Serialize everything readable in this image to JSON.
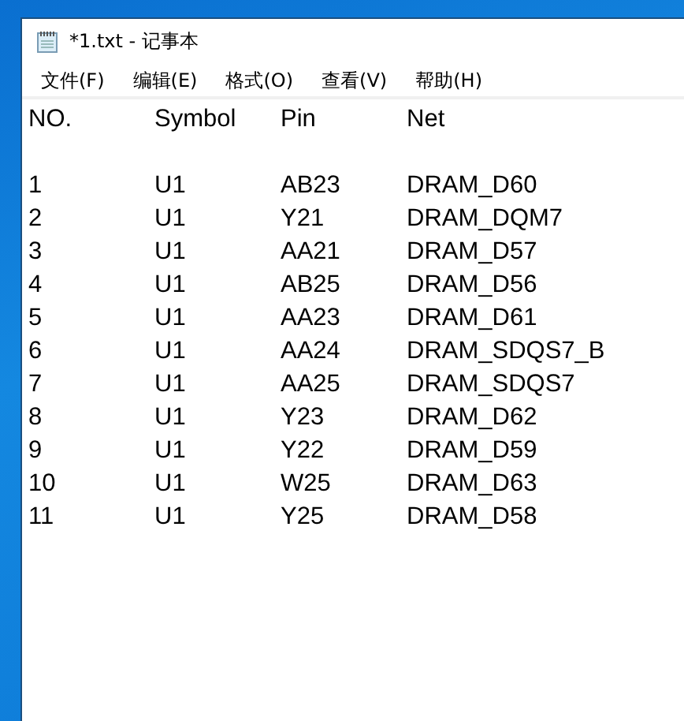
{
  "window": {
    "title": "*1.txt - 记事本"
  },
  "menu": [
    "文件(F)",
    "编辑(E)",
    "格式(O)",
    "查看(V)",
    "帮助(H)"
  ],
  "document": {
    "header": "NO.\tSymbol\tPin\tNet",
    "lines": [
      "1\tU1\tAB23\tDRAM_D60",
      "2\tU1\tY21\tDRAM_DQM7",
      "3\tU1\tAA21\tDRAM_D57",
      "4\tU1\tAB25\tDRAM_D56",
      "5\tU1\tAA23\tDRAM_D61",
      "6\tU1\tAA24\tDRAM_SDQS7_B",
      "7\tU1\tAA25\tDRAM_SDQS7",
      "8\tU1\tY23\tDRAM_D62",
      "9\tU1\tY22\tDRAM_D59",
      "10\tU1\tW25\tDRAM_D63",
      "11\tU1\tY25\tDRAM_D58"
    ]
  }
}
